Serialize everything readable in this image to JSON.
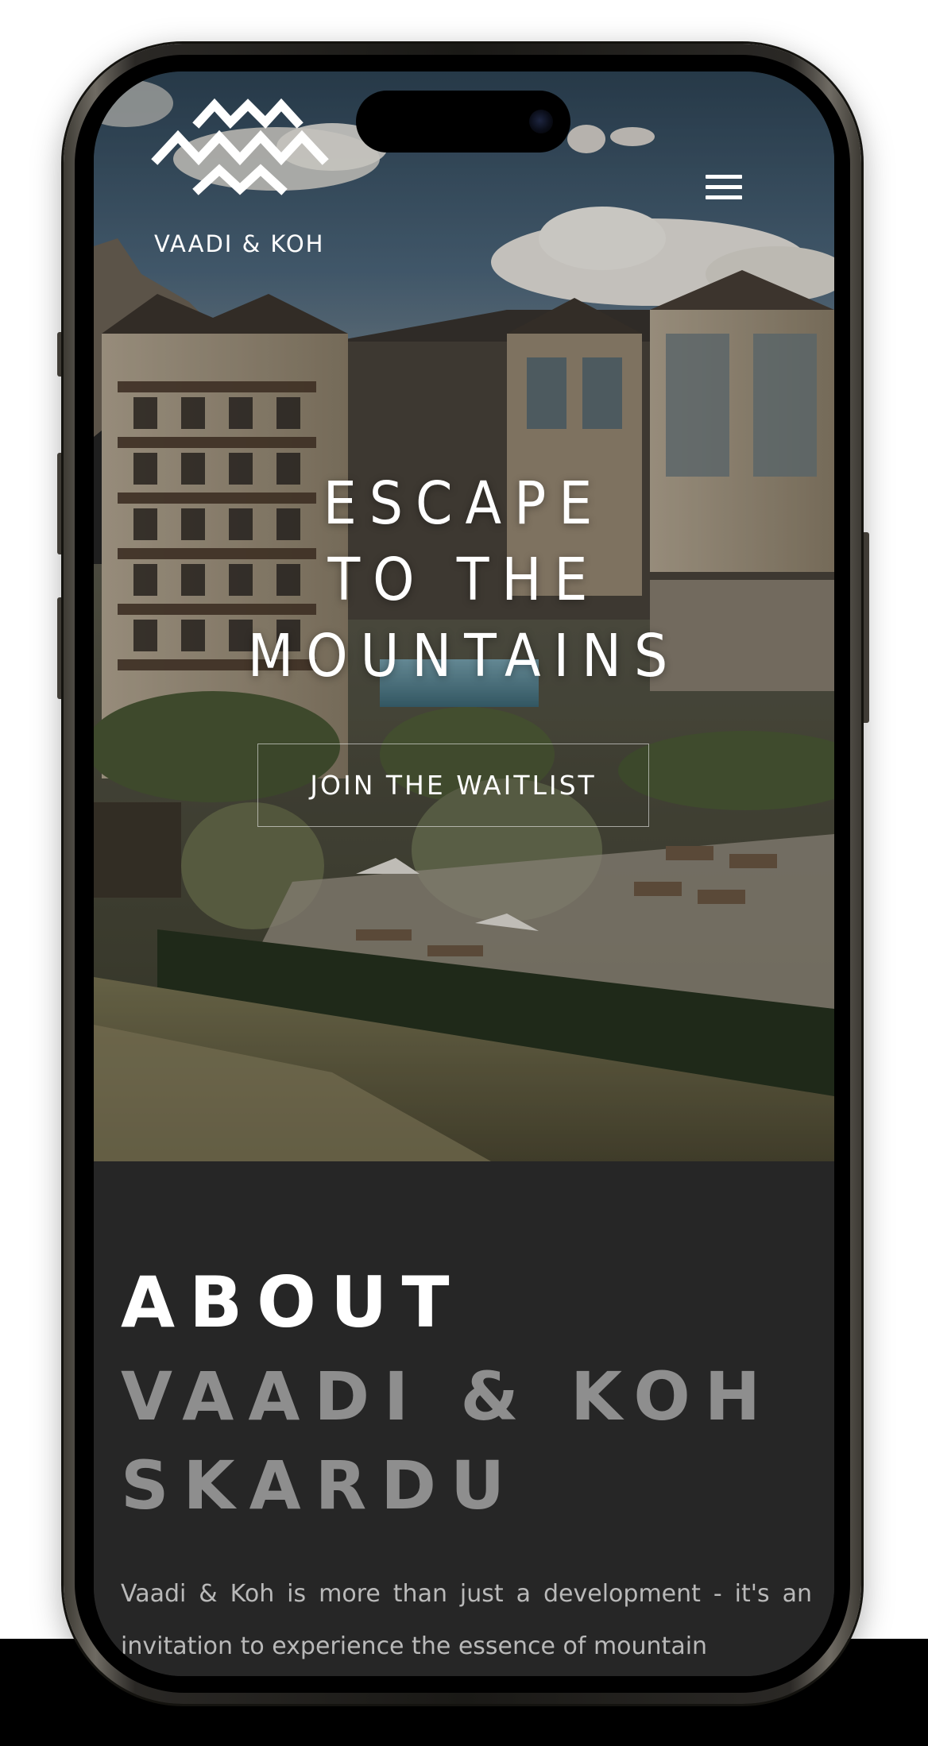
{
  "brand": {
    "name": "VAADI & KOH",
    "logo_icon": "mountain-chevrons-logo"
  },
  "nav": {
    "menu_icon": "hamburger-menu-icon"
  },
  "hero": {
    "headline_lines": [
      "ESCAPE",
      "TO THE",
      "MOUNTAINS"
    ],
    "cta_label": "JOIN THE WAITLIST"
  },
  "about": {
    "title": "ABOUT",
    "subtitle_lines": [
      "VAADI & KOH",
      "SKARDU"
    ],
    "body": "Vaadi & Koh is more than just a development - it's an invitation to experience the essence of mountain"
  },
  "colors": {
    "about_bg": "#262626",
    "about_sub": "#8e8e8e",
    "about_body": "#b9b9b9",
    "text_on_hero": "#ffffff"
  }
}
